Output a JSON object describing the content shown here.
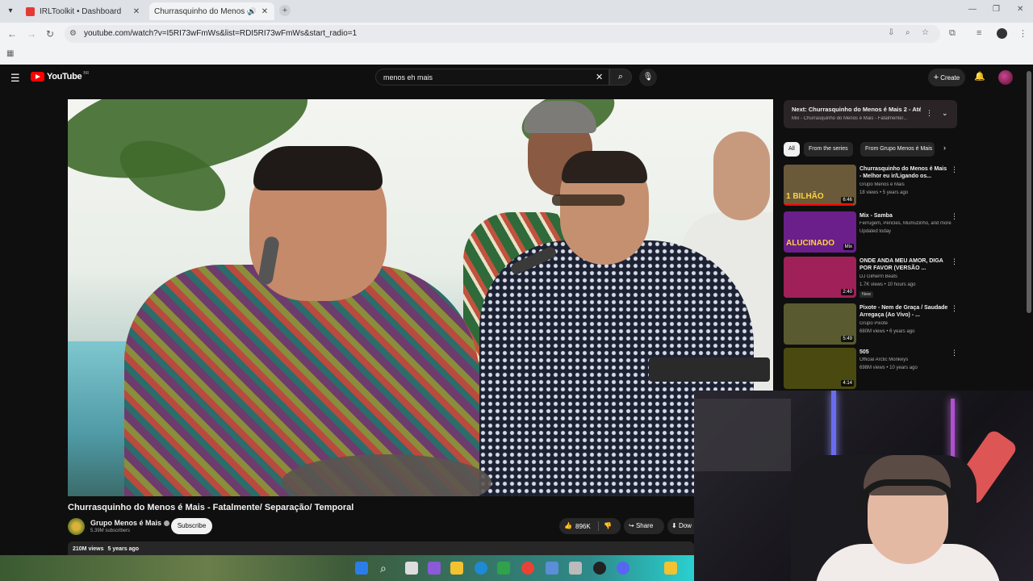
{
  "browser": {
    "tabs": [
      {
        "title": "IRLToolkit • Dashboard",
        "active": false
      },
      {
        "title": "Churrasquinho do Menos é",
        "active": true
      }
    ],
    "url": "youtube.com/watch?v=I5RI73wFmWs&list=RDI5RI73wFmWs&start_radio=1"
  },
  "youtube": {
    "search_value": "menos eh mais",
    "create_label": "Create",
    "video": {
      "title": "Churrasquinho do Menos é Mais - Fatalmente/ Separação/ Temporal",
      "channel": "Grupo Menos é Mais",
      "subscribers": "5.39M subscribers",
      "subscribe_label": "Subscribe",
      "likes": "896K",
      "share_label": "Share",
      "download_label": "Dow",
      "views": "210M views",
      "age": "5 years ago"
    },
    "up_next": {
      "title": "Next: Churrasquinho do Menos é Mais 2 - Até Q...",
      "subtitle": "Mix - Churrasquinho do Menos é Mais - Fatalmente/..."
    },
    "chips": [
      "All",
      "From the series",
      "From Grupo Menos é Mais"
    ],
    "recommendations": [
      {
        "title": "Churrasquinho do Menos é Mais - Melhor eu ir/Ligando os...",
        "channel": "Grupo Menos é Mais",
        "meta": "18 views • 5 years ago",
        "duration": "6:46",
        "thumb_text": "1 BILHÃO",
        "thumb_color": "#6a5a3a",
        "progress": 0.95
      },
      {
        "title": "Mix - Samba",
        "channel": "Ferrugem, Péricles, Mumuzinho, and more",
        "meta": "Updated today",
        "duration": "Mix",
        "thumb_text": "ALUCINADO",
        "thumb_color": "#6a1f8a",
        "progress": 0
      },
      {
        "title": "ONDE ANDA MEU AMOR, DIGA POR FAVOR (VERSÃO ...",
        "channel": "DJ Gilherm Beats",
        "meta": "1.7K views • 10 hours ago",
        "duration": "2:40",
        "badge": "New",
        "thumb_text": "",
        "thumb_color": "#a0205a",
        "progress": 0
      },
      {
        "title": "Pixote - Nem de Graça / Saudade Arregaça (Ao Vivo) - ...",
        "channel": "Grupo Pixote",
        "meta": "680M views • 6 years ago",
        "duration": "5:49",
        "thumb_text": "",
        "thumb_color": "#5a5a30",
        "progress": 0
      },
      {
        "title": "505",
        "channel": "Official Arctic Monkeys",
        "meta": "698M views • 10 years ago",
        "duration": "4:14",
        "thumb_text": "",
        "thumb_color": "#4a4a10",
        "progress": 0
      }
    ]
  }
}
